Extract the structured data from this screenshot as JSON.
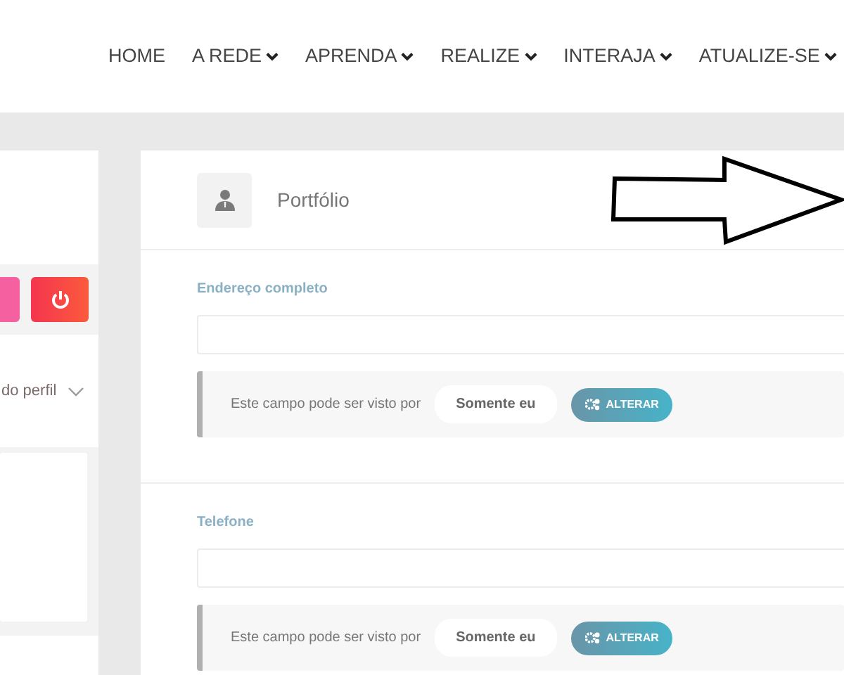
{
  "nav": {
    "items": [
      {
        "label": "HOME",
        "dropdown": false
      },
      {
        "label": "A REDE",
        "dropdown": true
      },
      {
        "label": "APRENDA",
        "dropdown": true
      },
      {
        "label": "REALIZE",
        "dropdown": true
      },
      {
        "label": "INTERAJA",
        "dropdown": true
      },
      {
        "label": "ATUALIZE-SE",
        "dropdown": true
      }
    ]
  },
  "sidebar": {
    "buttons": [
      {
        "kind": "pink"
      },
      {
        "kind": "power"
      }
    ],
    "menu_item": {
      "label": "do perfil",
      "expanded": false
    }
  },
  "panel": {
    "title": "Portfólio",
    "fields": [
      {
        "label": "Endereço completo",
        "visibility_text": "Este campo pode ser visto por",
        "visibility_value": "Somente eu",
        "button": "ALTERAR"
      },
      {
        "label": "Telefone",
        "visibility_text": "Este campo pode ser visto por",
        "visibility_value": "Somente eu",
        "button": "ALTERAR"
      }
    ]
  },
  "annotation": {
    "kind": "arrow"
  }
}
